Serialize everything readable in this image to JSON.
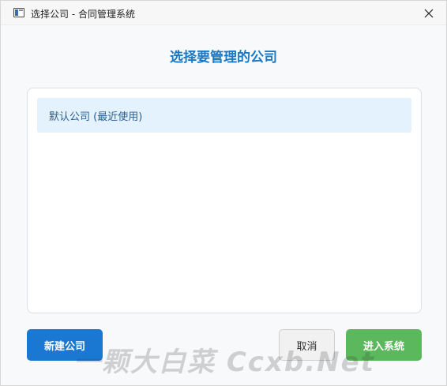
{
  "window": {
    "title": "选择公司 - 合同管理系统",
    "icons": {
      "app": "app-window-icon",
      "close": "close-icon"
    }
  },
  "main": {
    "heading": "选择要管理的公司",
    "companies": [
      {
        "label": "默认公司 (最近使用)",
        "selected": true
      }
    ]
  },
  "buttons": {
    "new_company": "新建公司",
    "cancel": "取消",
    "enter_system": "进入系统"
  },
  "watermark": {
    "text": "一颗大白菜 Ccxb.Net"
  },
  "colors": {
    "accent": "#1b78c4",
    "primary_button": "#1a77d2",
    "success_button": "#5cb85c",
    "selected_item_bg": "#e3f2fd"
  }
}
